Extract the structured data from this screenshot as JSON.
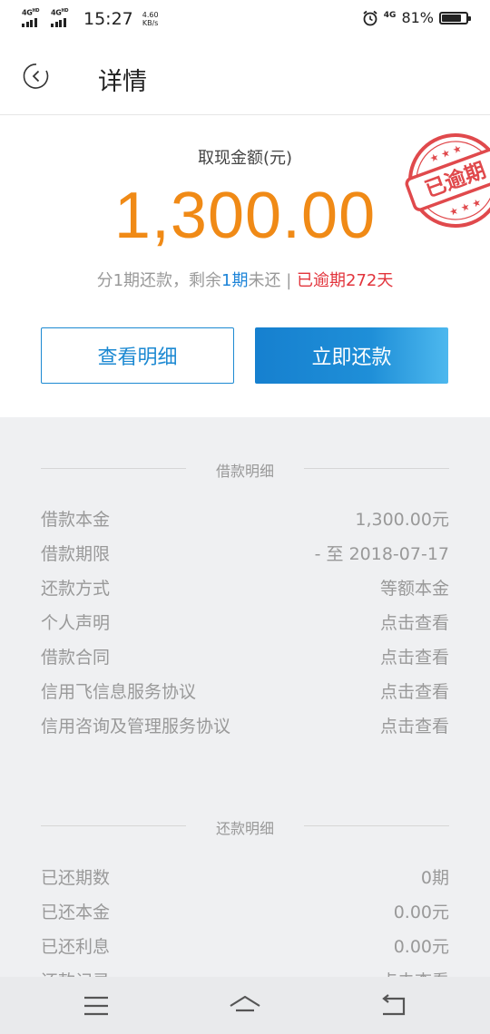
{
  "status_bar": {
    "net1": "4G",
    "net1_sup": "HD",
    "net2": "4G",
    "net2_sup": "HD",
    "time": "15:27",
    "speed_value": "4.60",
    "speed_unit": "KB/s",
    "net3": "4G",
    "battery_pct": "81%",
    "battery_level": 0.81
  },
  "nav": {
    "title": "详情",
    "back_icon": "back-icon"
  },
  "summary": {
    "amount_label": "取现金额(元)",
    "amount": "1,300.00",
    "plan_prefix": "分1期还款，剩余",
    "plan_remaining": "1期",
    "plan_suffix": "未还 |",
    "plan_overdue": "已逾期272天",
    "stamp_text": "已逾期",
    "detail_button": "查看明细",
    "repay_button": "立即还款",
    "colors": {
      "amount": "#f08a16",
      "accent": "#1c89d2",
      "overdue": "#e2343c"
    }
  },
  "loan_section": {
    "title": "借款明细",
    "rows": [
      {
        "label": "借款本金",
        "value": "1,300.00元"
      },
      {
        "label": "借款期限",
        "value": "- 至 2018-07-17"
      },
      {
        "label": "还款方式",
        "value": "等额本金"
      },
      {
        "label": "个人声明",
        "value": "点击查看"
      },
      {
        "label": "借款合同",
        "value": "点击查看"
      },
      {
        "label": "信用飞信息服务协议",
        "value": "点击查看"
      },
      {
        "label": "信用咨询及管理服务协议",
        "value": "点击查看"
      }
    ]
  },
  "repay_section": {
    "title": "还款明细",
    "rows": [
      {
        "label": "已还期数",
        "value": "0期"
      },
      {
        "label": "已还本金",
        "value": "0.00元"
      },
      {
        "label": "已还利息",
        "value": "0.00元"
      },
      {
        "label": "还款记录",
        "value": "点击查看"
      }
    ]
  },
  "bottom_nav": {
    "icons": [
      "menu-icon",
      "home-icon",
      "return-icon"
    ]
  }
}
